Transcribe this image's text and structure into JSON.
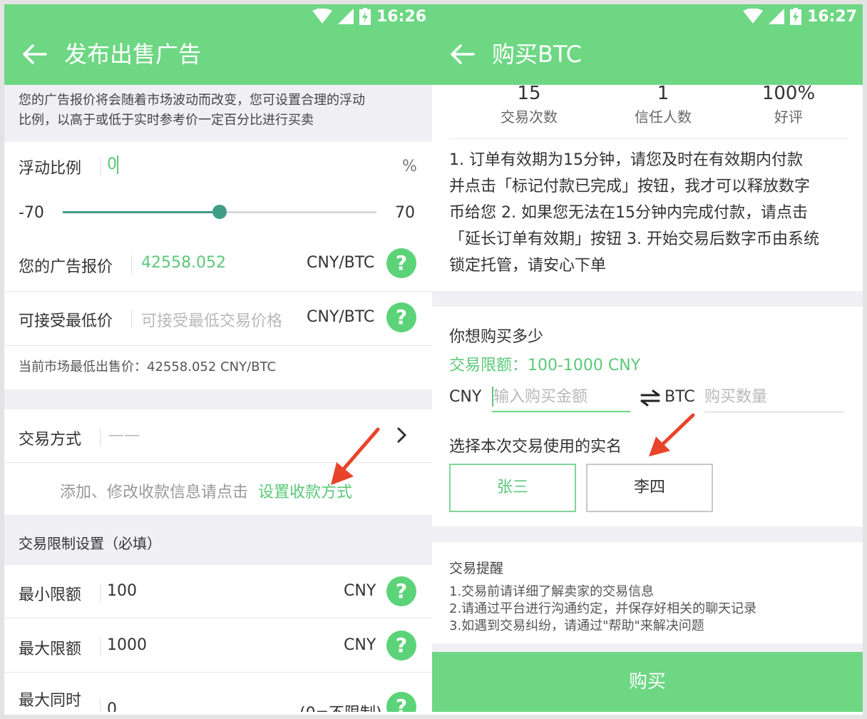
{
  "status": {
    "left_time": "16:26",
    "right_time": "16:27"
  },
  "left": {
    "title": "发布出售广告",
    "notice_line1": "您的广告报价将会随着市场波动而改变，您可设置合理的浮动",
    "notice_line2": "比例，以高于或低于实时参考价一定百分比进行买卖",
    "float_ratio": {
      "label": "浮动比例",
      "value": "0",
      "unit": "%"
    },
    "slider": {
      "min_label": "-70",
      "max_label": "70",
      "min": -70,
      "max": 70,
      "value": 0
    },
    "ad_price": {
      "label": "您的广告报价",
      "value": "42558.052",
      "unit": "CNY/BTC",
      "help": "?"
    },
    "min_price": {
      "label": "可接受最低价",
      "placeholder": "可接受最低交易价格",
      "unit": "CNY/BTC",
      "help": "?"
    },
    "market_low": "当前市场最低出售价：42558.052 CNY/BTC",
    "trade_method": {
      "label": "交易方式",
      "value": "——"
    },
    "payment_hint": "添加、修改收款信息请点击",
    "payment_link": "设置收款方式",
    "limits_header": "交易限制设置（必填）",
    "min_limit": {
      "label": "最小限额",
      "value": "100",
      "unit": "CNY",
      "help": "?"
    },
    "max_limit": {
      "label": "最大限额",
      "value": "1000",
      "unit": "CNY",
      "help": "?"
    },
    "max_concurrent": {
      "label": "最大同时",
      "value": "0",
      "unit": "(0=不限制)",
      "help": "?"
    }
  },
  "right": {
    "title": "购买BTC",
    "stats": [
      {
        "value": "15",
        "label": "交易次数"
      },
      {
        "value": "1",
        "label": "信任人数"
      },
      {
        "value": "100%",
        "label": "好评"
      }
    ],
    "terms": [
      "1. 订单有效期为15分钟，请您及时在有效期内付款",
      "并点击「标记付款已完成」按钮，我才可以释放数字",
      "币给您 2. 如果您无法在15分钟内完成付款，请点击",
      "「延长订单有效期」按钮 3. 开始交易后数字币由系统",
      "锁定托管，请安心下单"
    ],
    "how_much": "你想购买多少",
    "limit_text": "交易限额：100-1000 CNY",
    "cny_label": "CNY",
    "cny_placeholder": "输入购买金额",
    "btc_label": "BTC",
    "btc_placeholder": "购买数量",
    "choose_name": "选择本次交易使用的实名",
    "names": [
      "张三",
      "李四"
    ],
    "reminder_title": "交易提醒",
    "reminders": [
      "1.交易前请详细了解卖家的交易信息",
      "2.请通过平台进行沟通约定，并保存好相关的聊天记录",
      "3.如遇到交易纠纷，请通过\"帮助\"来解决问题"
    ],
    "buy_label": "购买"
  },
  "colors": {
    "accent": "#6dd783",
    "link_green": "#5cc878",
    "slider": "#3f9e86",
    "annotation_arrow": "#e8442a"
  }
}
